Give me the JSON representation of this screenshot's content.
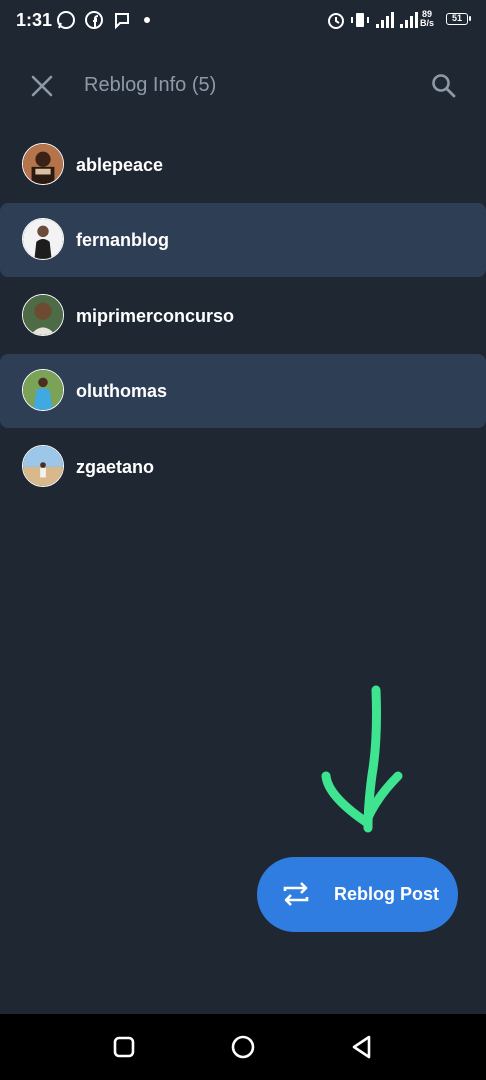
{
  "status_bar": {
    "time": "1:31",
    "network_speed_top": "89",
    "network_speed_bottom": "B/s",
    "battery": "51",
    "icons": [
      "whatsapp-icon",
      "facebook-icon",
      "chat-icon",
      "dot-icon",
      "alarm-icon",
      "vibrate-icon",
      "signal-icon",
      "signal-icon"
    ]
  },
  "header": {
    "title": "Reblog Info (5)",
    "close_icon": "close-icon",
    "search_icon": "search-icon"
  },
  "users": [
    {
      "name": "ablepeace",
      "highlighted": false
    },
    {
      "name": "fernanblog",
      "highlighted": true
    },
    {
      "name": "miprimerconcurso",
      "highlighted": false
    },
    {
      "name": "oluthomas",
      "highlighted": true
    },
    {
      "name": "zgaetano",
      "highlighted": false
    }
  ],
  "fab": {
    "label": "Reblog Post",
    "icon": "repeat-icon"
  },
  "nav": [
    "square-icon",
    "circle-icon",
    "back-triangle-icon"
  ],
  "colors": {
    "background": "#1f2733",
    "highlight_row": "#2e3e55",
    "fab": "#2f7de1",
    "title_text": "#8e99a8",
    "annotation": "#3ee48f"
  }
}
